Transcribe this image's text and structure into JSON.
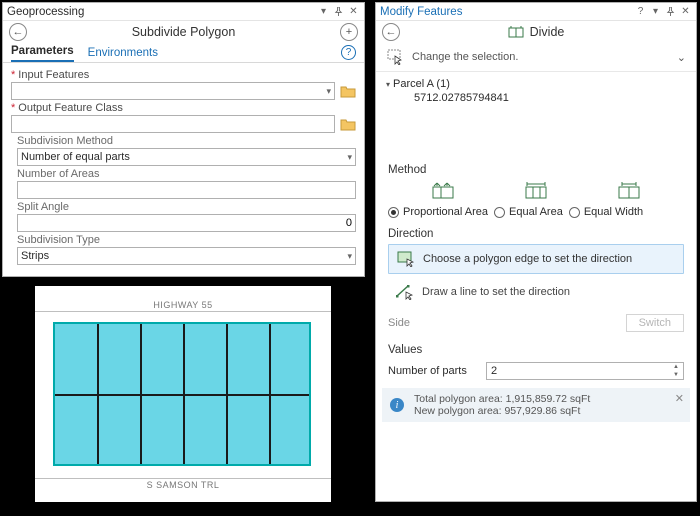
{
  "geop": {
    "title": "Geoprocessing",
    "tool_name": "Subdivide Polygon",
    "tabs": {
      "parameters": "Parameters",
      "environments": "Environments"
    },
    "input_features_label": "Input Features",
    "input_features_value": "",
    "output_fc_label": "Output Feature Class",
    "output_fc_value": "",
    "subdiv_method_label": "Subdivision Method",
    "subdiv_method_value": "Number of equal parts",
    "num_areas_label": "Number of Areas",
    "num_areas_value": "",
    "split_angle_label": "Split Angle",
    "split_angle_value": "0",
    "subdiv_type_label": "Subdivision Type",
    "subdiv_type_value": "Strips"
  },
  "modify": {
    "title": "Modify Features",
    "tool_name": "Divide",
    "change_selection": "Change the selection.",
    "tree_parent": "Parcel A (1)",
    "tree_child": "5712.02785794841",
    "method_label": "Method",
    "opt_prop": "Proportional Area",
    "opt_equal_area": "Equal Area",
    "opt_equal_width": "Equal Width",
    "direction_label": "Direction",
    "dir_choose_edge": "Choose a polygon edge to set the direction",
    "dir_draw_line": "Draw a line to set the direction",
    "side_label": "Side",
    "switch_btn": "Switch",
    "values_label": "Values",
    "num_parts_label": "Number of parts",
    "num_parts_value": "2",
    "info_line1": "Total polygon area: 1,915,859.72 sqFt",
    "info_line2": "New polygon area: 957,929.86 sqFt"
  },
  "map": {
    "top_road": "HIGHWAY 55",
    "bottom_road": "S SAMSON TRL"
  }
}
